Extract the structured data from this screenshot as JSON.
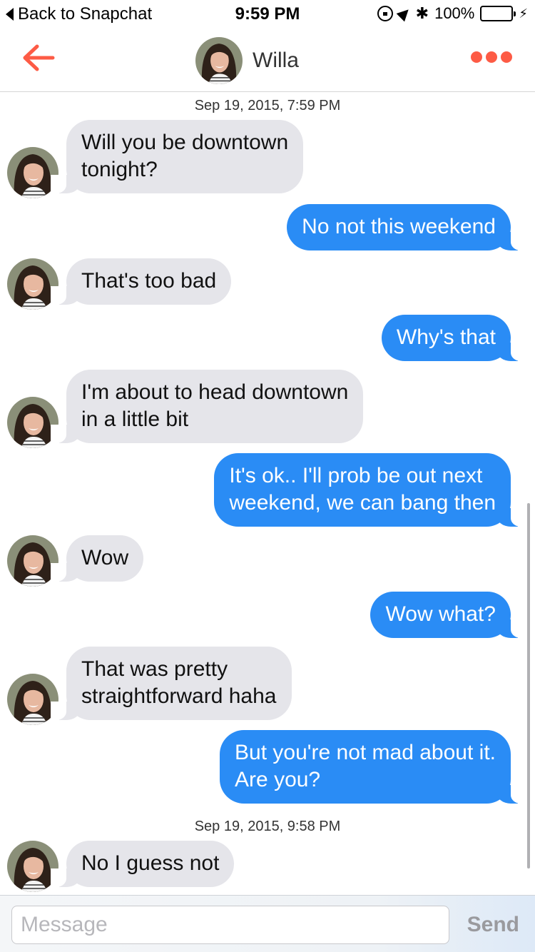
{
  "status_bar": {
    "back_label": "Back to Snapchat",
    "time": "9:59 PM",
    "battery": "100%",
    "battery_fill": 1.0
  },
  "nav": {
    "contact_name": "Willa",
    "accent_color": "#fd5b45",
    "back_icon": "arrow-left-icon",
    "more_icon": "more-dots-icon"
  },
  "conversation": {
    "timestamps": [
      "Sep 19, 2015, 7:59 PM",
      "Sep 19, 2015, 9:58 PM"
    ],
    "messages": [
      {
        "from": "them",
        "lines": [
          "Will you be downtown",
          "tonight?"
        ]
      },
      {
        "from": "me",
        "lines": [
          "No not this weekend"
        ]
      },
      {
        "from": "them",
        "lines": [
          "That's too bad"
        ]
      },
      {
        "from": "me",
        "lines": [
          "Why's that"
        ]
      },
      {
        "from": "them",
        "lines": [
          "I'm about to head downtown",
          "in a little bit"
        ]
      },
      {
        "from": "me",
        "lines": [
          "It's ok.. I'll prob be out next",
          "weekend, we can bang then"
        ]
      },
      {
        "from": "them",
        "lines": [
          "Wow"
        ]
      },
      {
        "from": "me",
        "lines": [
          "Wow what?"
        ]
      },
      {
        "from": "them",
        "lines": [
          "That was pretty",
          "straightforward haha"
        ]
      },
      {
        "from": "me",
        "lines": [
          "But you're not mad about it.",
          "Are you?"
        ]
      },
      {
        "from": "them",
        "lines": [
          "No I guess not"
        ]
      }
    ]
  },
  "composer": {
    "placeholder": "Message",
    "send_label": "Send"
  },
  "colors": {
    "incoming_bubble": "#e5e5ea",
    "outgoing_bubble": "#2a8cf5"
  }
}
